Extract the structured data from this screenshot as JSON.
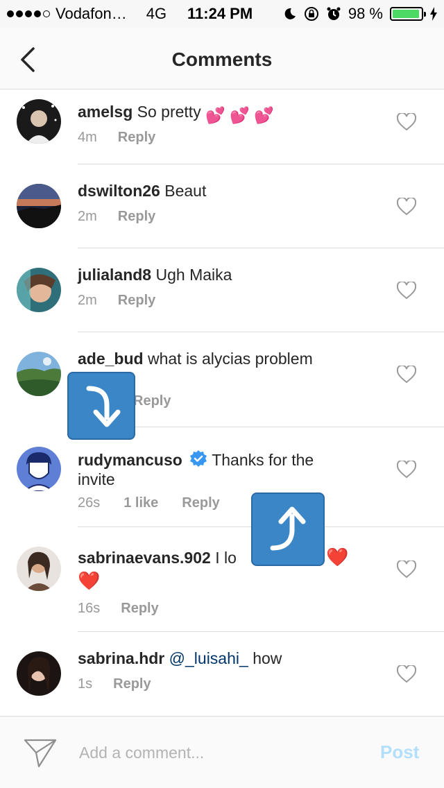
{
  "status_bar": {
    "carrier": "Vodafon…",
    "network": "4G",
    "time": "11:24 PM",
    "battery": "98 %",
    "battery_level": 0.98,
    "signal_strength": 4
  },
  "header": {
    "title": "Comments"
  },
  "comments": [
    {
      "username": "amelsg",
      "text": "So pretty",
      "emoji": "💕 💕 💕",
      "time": "4m",
      "reply": "Reply"
    },
    {
      "username": "dswilton26",
      "text": "Beaut",
      "time": "2m",
      "reply": "Reply"
    },
    {
      "username": "julialand8",
      "text": "Ugh Maika",
      "time": "2m",
      "reply": "Reply"
    },
    {
      "username": "ade_bud",
      "text": "what is alycias problem",
      "time": "",
      "reply": "Reply"
    },
    {
      "username": "rudymancuso",
      "verified": true,
      "text": "Thanks for the invite",
      "time": "26s",
      "likes": "1 like",
      "reply": "Reply"
    },
    {
      "username": "sabrinaevans.902",
      "text": "I lo",
      "emoji": "❤️",
      "time": "16s",
      "reply": "Reply"
    },
    {
      "username": "sabrina.hdr",
      "mention": "@_luisahi_",
      "text": "how",
      "time": "1s",
      "reply": "Reply"
    }
  ],
  "composer": {
    "placeholder": "Add a comment...",
    "post_label": "Post"
  },
  "colors": {
    "accent_blue": "#3a86c7",
    "post_disabled": "#b2dffc",
    "meta_gray": "#999999",
    "heart_red": "#e0245e"
  }
}
